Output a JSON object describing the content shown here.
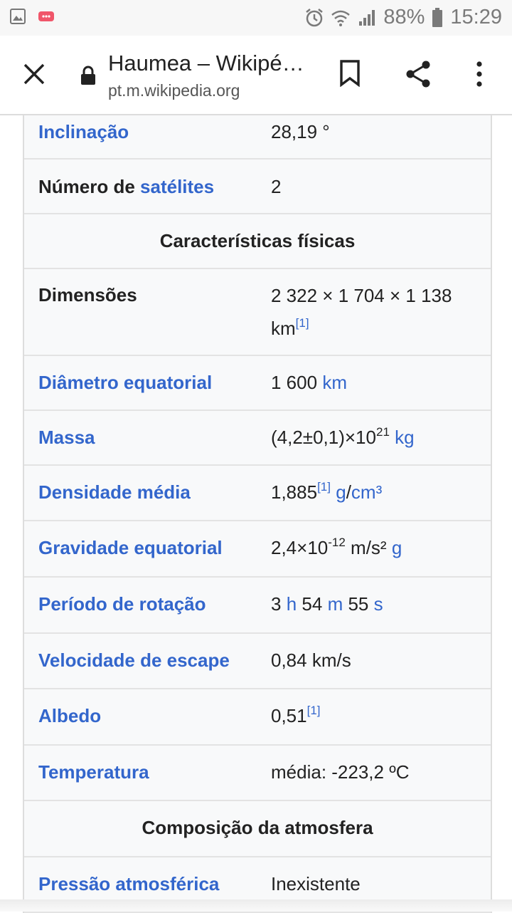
{
  "status_bar": {
    "battery": "88%",
    "time": "15:29"
  },
  "toolbar": {
    "title": "Haumea – Wikipé…",
    "url": "pt.m.wikipedia.org"
  },
  "rows": {
    "inclinacao": {
      "label": "Inclinação",
      "value": "28,19 °"
    },
    "satelites": {
      "label_prefix": "Número de ",
      "label_link": "satélites",
      "value": "2"
    },
    "caracteristicas": {
      "header": "Características físicas"
    },
    "dimensoes": {
      "label": "Dimensões",
      "value_line1": "2 322 × 1 704 × 1 138",
      "value_line2": "km",
      "ref": "[1]"
    },
    "diametro": {
      "label": "Diâmetro equatorial",
      "value": "1 600",
      "unit": "km"
    },
    "massa": {
      "label": "Massa",
      "value": "(4,2±0,1)×10",
      "exp": "21",
      "unit": "kg"
    },
    "densidade": {
      "label": "Densidade média",
      "value": "1,885",
      "ref": "[1]",
      "unit_g": "g",
      "slash": "/",
      "unit_cm": "cm³"
    },
    "gravidade": {
      "label": "Gravidade equatorial",
      "value": "2,4×10",
      "exp": "-12",
      "unit": " m/s²",
      "unit_g": "g"
    },
    "periodo": {
      "label": "Período de rotação",
      "n1": "3",
      "u1": "h",
      "n2": "54",
      "u2": "m",
      "n3": "55",
      "u3": "s"
    },
    "velocidade": {
      "label": "Velocidade de escape",
      "value": "0,84 km/s"
    },
    "albedo": {
      "label": "Albedo",
      "value": "0,51",
      "ref": "[1]"
    },
    "temperatura": {
      "label": "Temperatura",
      "value": "média: -223,2 ºC"
    },
    "composicao": {
      "header": "Composição da atmosfera"
    },
    "pressao": {
      "label": "Pressão atmosférica",
      "value": "Inexistente"
    }
  }
}
